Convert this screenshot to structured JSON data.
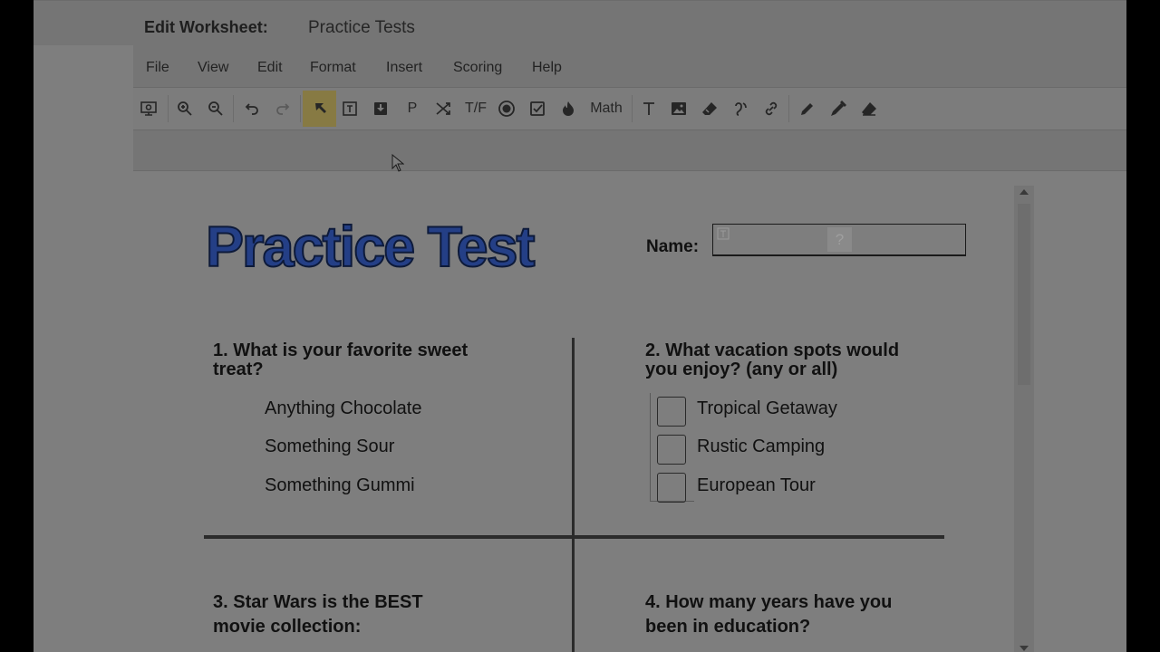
{
  "header": {
    "label": "Edit Worksheet:",
    "worksheet_name": "Practice Tests"
  },
  "menu": [
    "File",
    "View",
    "Edit",
    "Format",
    "Insert",
    "Scoring",
    "Help"
  ],
  "toolbar": {
    "tf_label": "T/F",
    "math_label": "Math",
    "p_label": "P"
  },
  "worksheet": {
    "title": "Practice Test",
    "name_label": "Name:",
    "name_help": "?",
    "q1": {
      "line1": "1. What is your favorite sweet",
      "line2": "treat?",
      "options": [
        "Anything Chocolate",
        "Something Sour",
        "Something Gummi"
      ]
    },
    "q2": {
      "line1": "2. What vacation spots would",
      "line2": "you enjoy? (any or all)",
      "options": [
        "Tropical Getaway",
        "Rustic Camping",
        "European Tour"
      ]
    },
    "q3": {
      "line1": "3. Star Wars is the BEST",
      "line2": "movie collection:"
    },
    "q4": {
      "line1": "4. How many years have you",
      "line2": "been in education?"
    }
  },
  "colors": {
    "logo_fill": "#243f86",
    "logo_stroke": "#0d1a3a",
    "highlight": "#877a43"
  }
}
